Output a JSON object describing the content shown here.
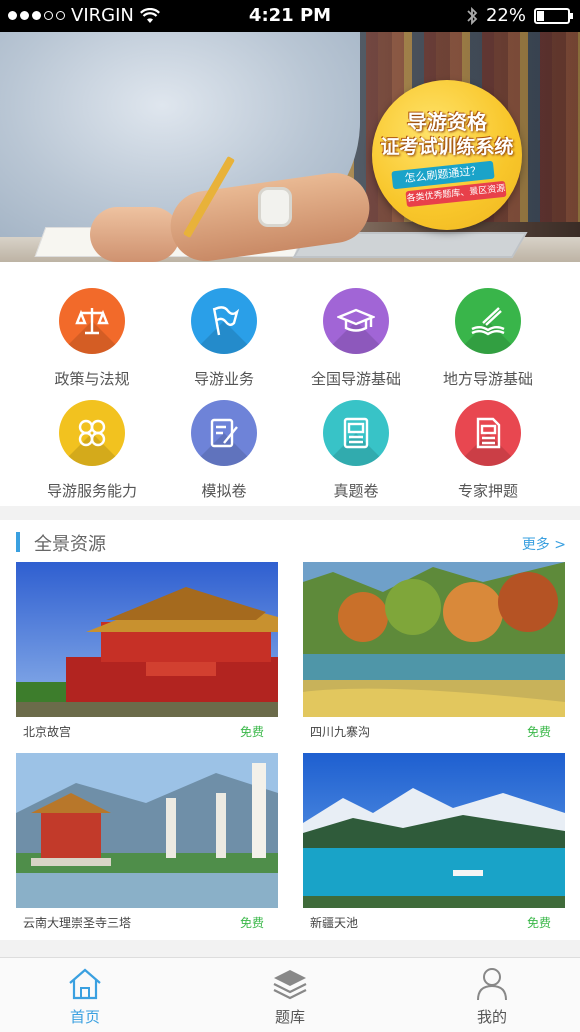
{
  "status_bar": {
    "carrier": "VIRGIN",
    "time": "4:21 PM",
    "battery": "22%",
    "battery_level": 0.22
  },
  "banner": {
    "title_line1": "导游资格",
    "title_line2": "证考试训练系统",
    "tagline": "怎么刷题通过？",
    "subtag": "各类优秀题库、景区资源"
  },
  "categories": [
    {
      "label": "政策与法规",
      "icon": "scale-icon",
      "color": "#f26a2a"
    },
    {
      "label": "导游业务",
      "icon": "flag-icon",
      "color": "#2a9fe8"
    },
    {
      "label": "全国导游基础",
      "icon": "graduation-cap-icon",
      "color": "#a165d6"
    },
    {
      "label": "地方导游基础",
      "icon": "book-pen-icon",
      "color": "#39b54a"
    },
    {
      "label": "导游服务能力",
      "icon": "clover-icon",
      "color": "#f2c21f"
    },
    {
      "label": "模拟卷",
      "icon": "edit-document-icon",
      "color": "#6e83d8"
    },
    {
      "label": "真题卷",
      "icon": "exam-paper-icon",
      "color": "#38c3c7"
    },
    {
      "label": "专家押题",
      "icon": "prediction-paper-icon",
      "color": "#e84750"
    }
  ],
  "panorama": {
    "title": "全景资源",
    "more": "更多 >",
    "items": [
      {
        "name": "北京故宫",
        "price": "免费"
      },
      {
        "name": "四川九寨沟",
        "price": "免费"
      },
      {
        "name": "云南大理崇圣寺三塔",
        "price": "免费"
      },
      {
        "name": "新疆天池",
        "price": "免费"
      }
    ]
  },
  "tabs": [
    {
      "label": "首页",
      "icon": "home-icon",
      "active": true
    },
    {
      "label": "题库",
      "icon": "layers-icon",
      "active": false
    },
    {
      "label": "我的",
      "icon": "user-icon",
      "active": false
    }
  ],
  "colors": {
    "accent": "#3aa0e0",
    "free": "#3bb84a"
  }
}
